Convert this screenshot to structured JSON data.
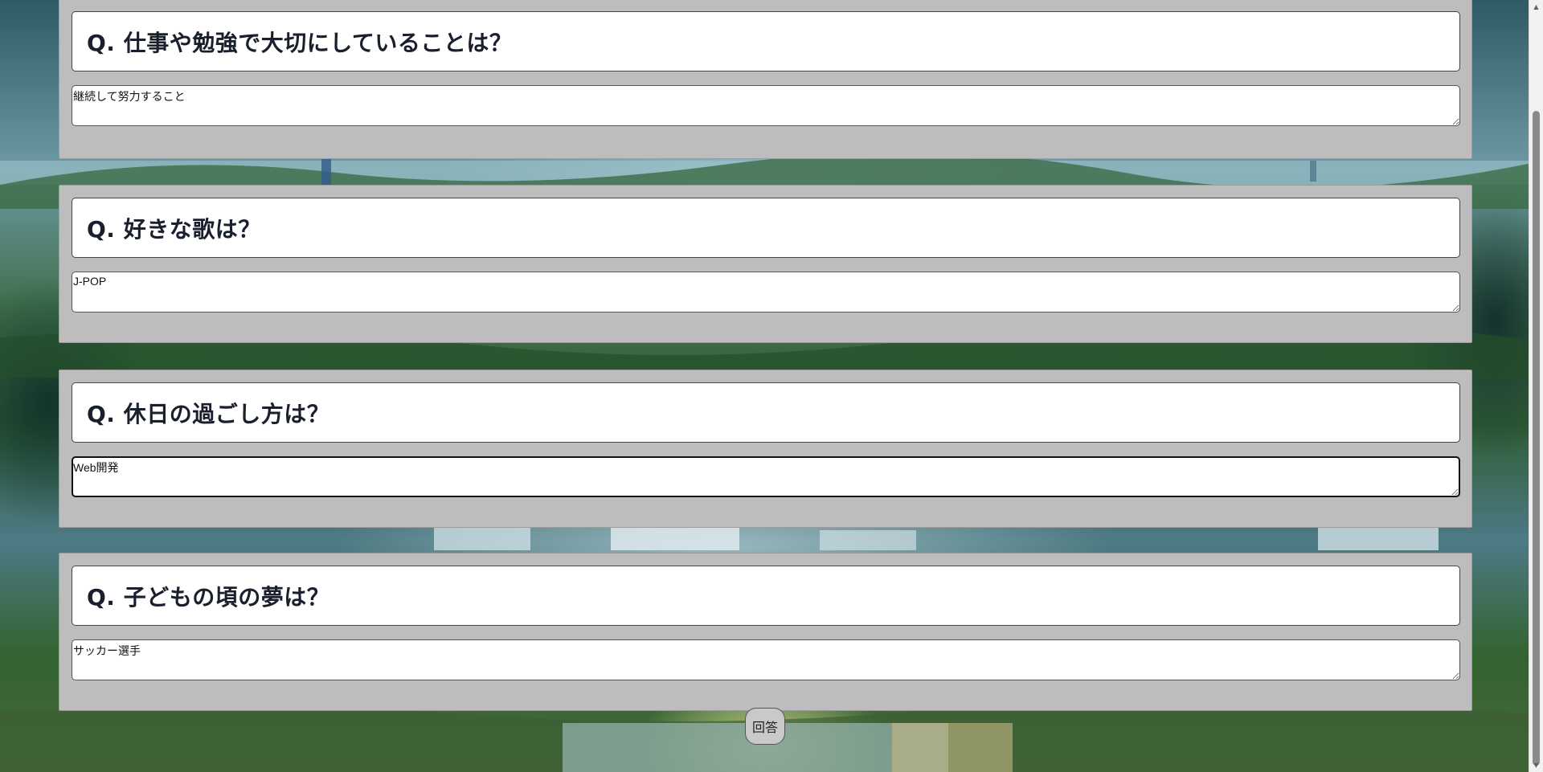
{
  "questions": [
    {
      "question": "Q. 仕事や勉強で大切にしていることは？",
      "answer": "継続して努力すること"
    },
    {
      "question": "Q. 好きな歌は？",
      "answer": "J-POP"
    },
    {
      "question": "Q. 休日の過ごし方は？",
      "answer": "Web開発"
    },
    {
      "question": "Q. 子どもの頃の夢は？",
      "answer": "サッカー選手"
    }
  ],
  "submit_label": "回答",
  "icons": {
    "scroll_up": "scroll-up-arrow-icon",
    "scroll_down": "scroll-down-arrow-icon"
  }
}
